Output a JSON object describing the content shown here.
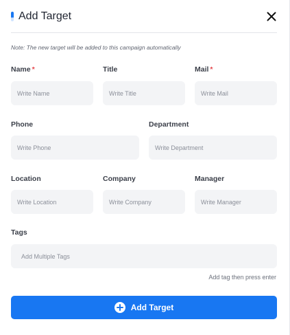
{
  "header": {
    "title": "Add Target"
  },
  "note": "Note: The new target will be added to this campaign automatically",
  "fields": {
    "name": {
      "label": "Name",
      "required": "*",
      "placeholder": "Write Name",
      "value": ""
    },
    "title": {
      "label": "Title",
      "placeholder": "Write Title",
      "value": ""
    },
    "mail": {
      "label": "Mail",
      "required": "*",
      "placeholder": "Write Mail",
      "value": ""
    },
    "phone": {
      "label": "Phone",
      "placeholder": "Write Phone",
      "value": ""
    },
    "department": {
      "label": "Department",
      "placeholder": "Write Department",
      "value": ""
    },
    "location": {
      "label": "Location",
      "placeholder": "Write Location",
      "value": ""
    },
    "company": {
      "label": "Company",
      "placeholder": "Write Company",
      "value": ""
    },
    "manager": {
      "label": "Manager",
      "placeholder": "Write Manager",
      "value": ""
    },
    "tags": {
      "label": "Tags",
      "placeholder": "Add Multiple Tags",
      "hint": "Add tag then press enter",
      "value": ""
    }
  },
  "submit": {
    "label": "Add Target"
  },
  "icons": {
    "close": "close-icon",
    "submit": "plus-circle-icon",
    "title_accent": "accent-bar"
  },
  "colors": {
    "accent": "#1877f2",
    "required": "#e5484d",
    "input_bg": "#f3f4f6"
  }
}
